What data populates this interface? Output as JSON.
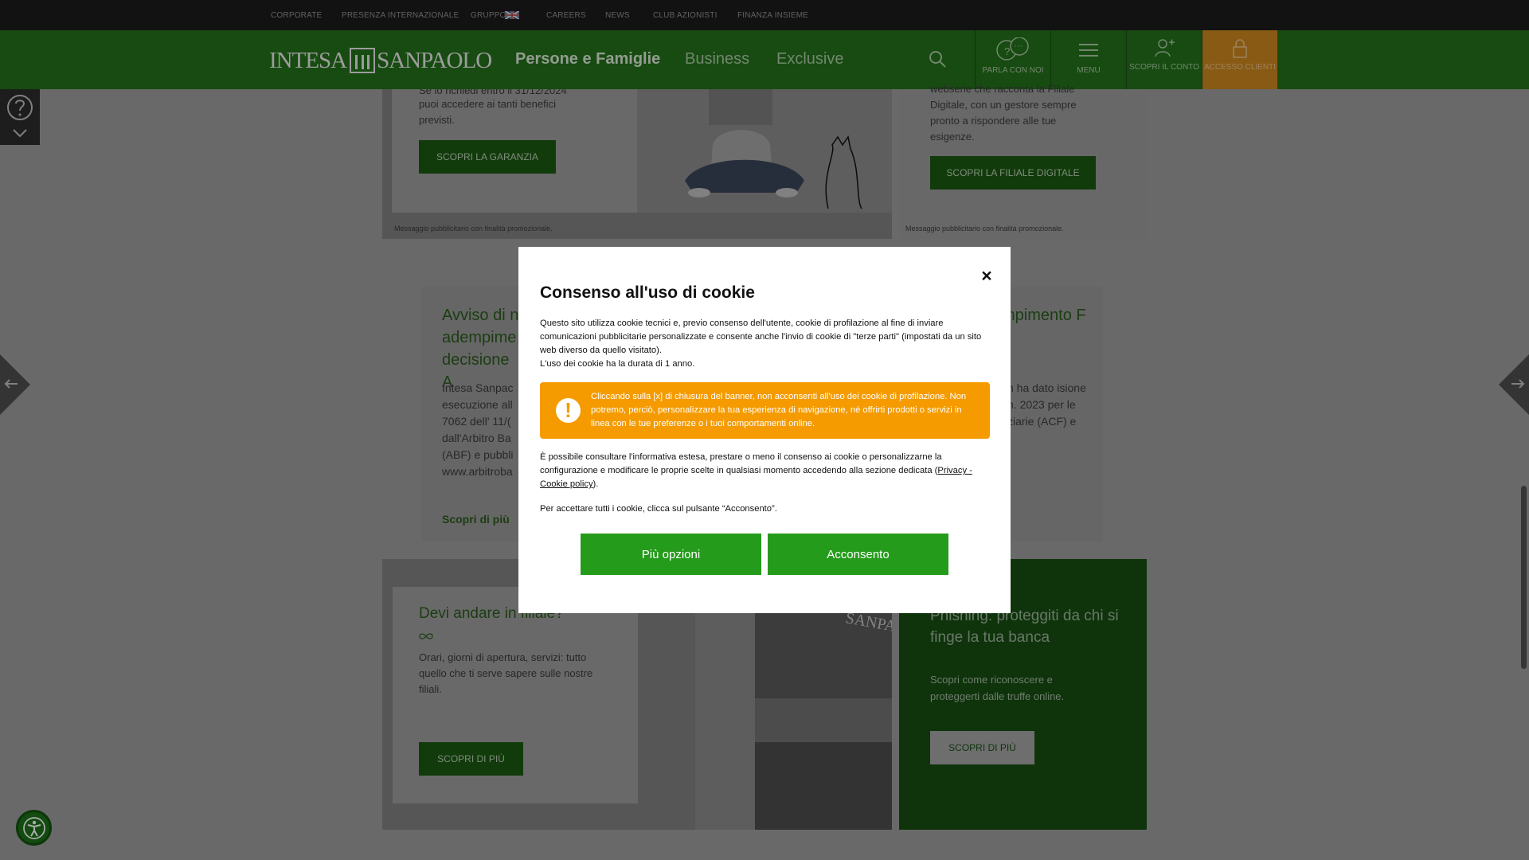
{
  "top_nav": [
    "CORPORATE",
    "PRESENZA INTERNAZIONALE",
    "GRUPPO",
    "CAREERS",
    "NEWS",
    "CLUB AZIONISTI",
    "FINANZA INSIEME"
  ],
  "header": {
    "logo_left": "INTESA",
    "logo_right": "SANPAOLO",
    "nav": [
      "Persone e Famiglie",
      "Business",
      "Exclusive"
    ],
    "buttons": [
      "PARLA CON NOI",
      "MENU",
      "SCOPRI IL CONTO",
      "ACCESSO CLIENTI"
    ]
  },
  "cards": {
    "garanzia": {
      "text_fragment": "Se lo richiedi entro il 31/12/2024",
      "body": "puoi accedere ai tanti benefici previsti.",
      "button": "SCOPRI LA GARANZIA",
      "disclaimer": "Messaggio pubblicitario con finalità promozionale."
    },
    "filiale_digitale": {
      "body": "webserie che racconta la Filiale Digitale, con un gestore sempre pronto a rispondere alle tue esigenze.",
      "button": "SCOPRI LA FILIALE DIGITALE",
      "disclaimer": "Messaggio pubblicitario con finalità promozionale."
    },
    "avviso": {
      "title": "Avviso di n adempime decisione A",
      "body": "Intesa Sanpac esecuzione all 7062 dell' 11/( dall'Arbitro Ba (ABF) e pubbli www.arbitroba",
      "link": "Scopri di più"
    },
    "avviso_right": {
      "title": "mpimento F",
      "body": "n ha dato isione n. 2023 per le ziarie (ACF) e"
    },
    "filiale": {
      "title": "Devi andare in filiale?",
      "body": "Orari, giorni di apertura, servizi: tutto quello che ti serve sapere sulle nostre filiali.",
      "button": "SCOPRI DI PIÙ",
      "sign": "SANPAOLO"
    },
    "phishing": {
      "title": "Phishing: proteggiti da chi si finge la tua banca",
      "body": "Scopri come riconoscere e proteggerti dalle truffe online.",
      "button": "SCOPRI DI PIÙ"
    }
  },
  "cookie_modal": {
    "title": "Consenso all'uso di cookie",
    "intro": "Questo sito utilizza cookie tecnici e, previo consenso dell'utente, cookie di profilazione al fine di inviare comunicazioni pubblicitarie personalizzate e consente anche l'invio di cookie di \"terze parti\" (impostati da un sito web diverso da quello visitato).",
    "duration": "L'uso dei cookie ha la durata di 1 anno.",
    "warning": "Cliccando sulla [x] di chiusura del banner, non acconsenti all'uso dei cookie di profilazione. Non potremo, perciò, personalizzare la tua esperienza di navigazione, né offrirti prodotti o servizi in linea con le tue preferenze o i tuoi comportamenti online.",
    "info_before": "È possibile consultare l'informativa estesa, prestare o meno il consenso ai cookie o personalizzarne la configurazione e modificare le proprie scelte in qualsiasi momento accedendo alla sezione dedicata (",
    "info_link": "Privacy - Cookie policy",
    "info_after": ").",
    "accept_text": "Per accettare tutti i cookie, clicca sul pulsante “Acconsento”.",
    "options_button": "Più opzioni",
    "accept_button": "Acconsento"
  },
  "colors": {
    "brand_green": "#259b1b",
    "warning_orange": "#f59b00",
    "accent_orange": "#c9851e"
  }
}
